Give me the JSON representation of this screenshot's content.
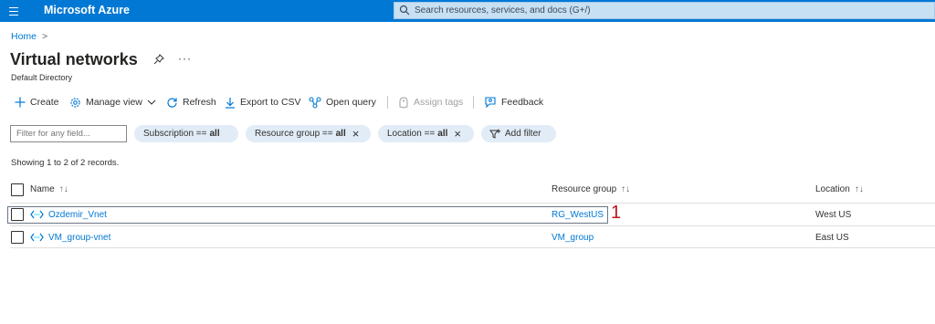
{
  "topbar": {
    "brand": "Microsoft Azure",
    "search_placeholder": "Search resources, services, and docs (G+/)"
  },
  "breadcrumb": {
    "home": "Home",
    "chevron": ">"
  },
  "page": {
    "title": "Virtual networks",
    "subtitle": "Default Directory",
    "more": "···"
  },
  "toolbar": {
    "create": "Create",
    "manage_view": "Manage view",
    "refresh": "Refresh",
    "export_csv": "Export to CSV",
    "open_query": "Open query",
    "assign_tags": "Assign tags",
    "feedback": "Feedback"
  },
  "filters": {
    "placeholder": "Filter for any field...",
    "subscription": {
      "label": "Subscription ==",
      "value": "all"
    },
    "resource_group": {
      "label": "Resource group ==",
      "value": "all"
    },
    "location": {
      "label": "Location ==",
      "value": "all"
    },
    "add_filter": "Add filter"
  },
  "records_text": "Showing 1 to 2 of 2 records.",
  "table": {
    "columns": {
      "name": "Name",
      "resource_group": "Resource group",
      "location": "Location"
    },
    "sort_glyph": "↑↓",
    "rows": [
      {
        "name": "Ozdemir_Vnet",
        "resource_group": "RG_WestUS",
        "location": "West US"
      },
      {
        "name": "VM_group-vnet",
        "resource_group": "VM_group",
        "location": "East US"
      }
    ]
  },
  "annotation": "1",
  "colors": {
    "accent": "#0078d4",
    "topbar": "#0078d4",
    "search_bg": "#c7e0f4",
    "pill_bg": "#e1ecf7",
    "annotation": "#c0141c"
  }
}
